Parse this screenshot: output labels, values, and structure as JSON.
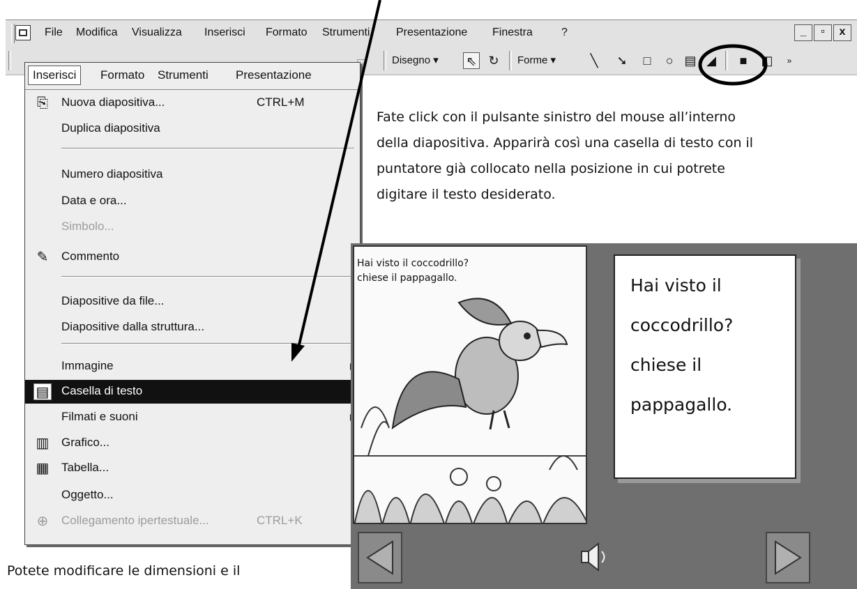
{
  "menubar": {
    "items": [
      "File",
      "Modifica",
      "Visualizza",
      "Inserisci",
      "Formato",
      "Strumenti",
      "Presentazione",
      "Finestra",
      "?"
    ],
    "window_controls": [
      "_",
      "▫",
      "x"
    ]
  },
  "toolbar": {
    "draw_label": "Disegno ▾",
    "shapes_label": "Forme ▾"
  },
  "dropdown": {
    "header": [
      "Inserisci",
      "Formato",
      "Strumenti",
      "Presentazione"
    ],
    "items": [
      {
        "label": "Nuova diapositiva...",
        "shortcut": "CTRL+M",
        "icon": "new-slide-icon"
      },
      {
        "label": "Duplica diapositiva"
      },
      {
        "label": "Numero diapositiva"
      },
      {
        "label": "Data e ora..."
      },
      {
        "label": "Simbolo...",
        "disabled": true
      },
      {
        "label": "Commento",
        "icon": "comment-icon"
      },
      {
        "label": "Diapositive da file..."
      },
      {
        "label": "Diapositive dalla struttura..."
      },
      {
        "label": "Immagine",
        "submenu": true
      },
      {
        "label": "Casella di testo",
        "icon": "text-box-icon",
        "selected": true
      },
      {
        "label": "Filmati e suoni",
        "submenu": true
      },
      {
        "label": "Grafico...",
        "icon": "chart-icon"
      },
      {
        "label": "Tabella...",
        "icon": "table-icon"
      },
      {
        "label": "Oggetto..."
      },
      {
        "label": "Collegamento ipertestuale...",
        "shortcut": "CTRL+K",
        "icon": "hyperlink-icon",
        "disabled": true
      }
    ]
  },
  "instructions": {
    "lines": [
      "Fate click con il pulsante sinistro del mouse all’interno",
      "della diapositiva. Apparirà così una casella di testo con il",
      "puntatore già collocato nella posizione in cui potrete",
      "digitare il testo desiderato."
    ],
    "bottom": "Potete modificare le dimensioni e il"
  },
  "slide": {
    "caption_lines": [
      "Hai visto il coccodrillo?",
      "chiese il pappagallo."
    ],
    "textbox_lines": [
      "Hai visto il",
      "coccodrillo?",
      "chiese il",
      "pappagallo."
    ]
  }
}
